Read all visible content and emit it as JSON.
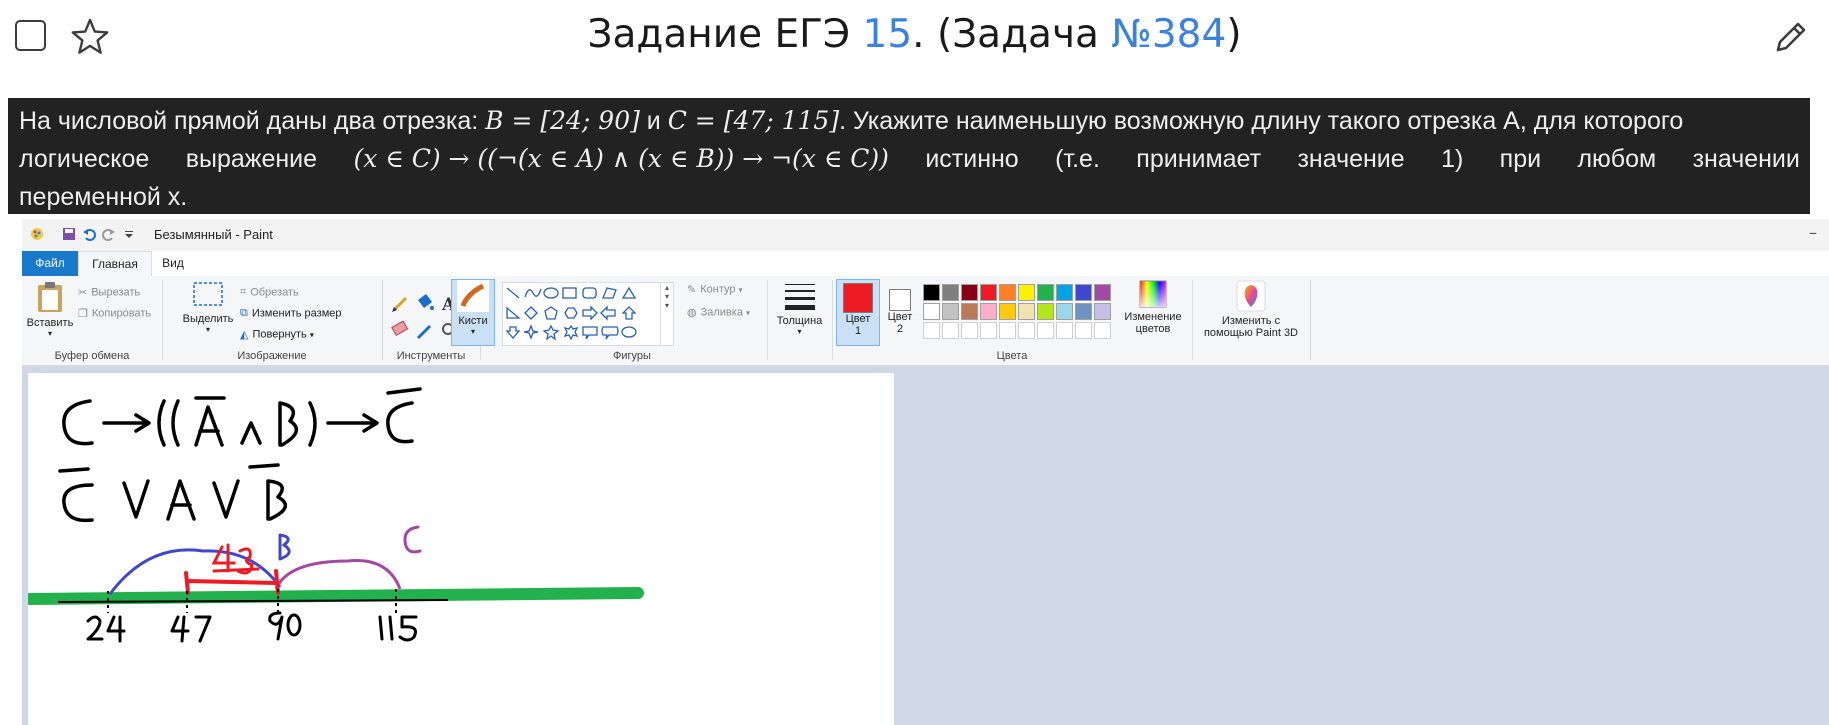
{
  "header": {
    "title_prefix": "Задание ЕГЭ ",
    "task_number": "15",
    "title_mid": ". (Задача ",
    "task_id": "№384",
    "title_suffix": ")"
  },
  "task": {
    "line1_a": "На числовой прямой даны два отрезка: ",
    "line1_B": "B = [24; 90]",
    "line1_and": " и ",
    "line1_C": "C = [47; 115]",
    "line1_b": ". Укажите наименьшую возможную длину такого отрезка A, для которого",
    "w_logical": "логическое",
    "w_expression": "выражение",
    "formula": "(x ∈ C) → ((¬(x ∈ A) ∧ (x ∈ B)) → ¬(x ∈ C))",
    "w_true": "истинно",
    "w_te": "(т.е.",
    "w_takes": "принимает",
    "w_value": "значение",
    "w_one": "1)",
    "w_at": "при",
    "w_any": "любом",
    "w_value2": "значении",
    "line3": "переменной х."
  },
  "paint": {
    "window_title": "Безымянный - Paint",
    "tabs": {
      "file": "Файл",
      "home": "Главная",
      "view": "Вид"
    },
    "clipboard": {
      "paste": "Вставить",
      "cut": "Вырезать",
      "copy": "Копировать",
      "label": "Буфер обмена"
    },
    "image": {
      "select": "Выделить",
      "crop": "Обрезать",
      "resize": "Изменить размер",
      "rotate": "Повернуть",
      "label": "Изображение"
    },
    "tools": {
      "label": "Инструменты"
    },
    "brushes": {
      "label": "Кисти"
    },
    "shapes": {
      "outline": "Контур",
      "fill": "Заливка",
      "label": "Фигуры"
    },
    "size": {
      "label": "Толщина"
    },
    "colors": {
      "color1_line1": "Цвет",
      "color1_line2": "1",
      "color2_line1": "Цвет",
      "color2_line2": "2",
      "edit_line1": "Изменение",
      "edit_line2": "цветов",
      "label": "Цвета",
      "color1_value": "#ed1c24",
      "color2_value": "#ffffff",
      "palette": [
        "#000000",
        "#7f7f7f",
        "#880015",
        "#ed1c24",
        "#ff7f27",
        "#fff200",
        "#22b14c",
        "#00a2e8",
        "#3f48cc",
        "#a349a4",
        "#ffffff",
        "#c3c3c3",
        "#b97a57",
        "#ffaec9",
        "#ffc90e",
        "#efe4b0",
        "#b5e61d",
        "#99d9ea",
        "#7092be",
        "#c8bfe7"
      ]
    },
    "paint3d": {
      "line1": "Изменить с",
      "line2": "помощью Paint 3D"
    }
  },
  "drawing": {
    "formula_line1": "C→((Ā ∧ B)→C̄",
    "formula_line2": "C̄ V A V B̄",
    "ticks": [
      "24",
      "47",
      "90",
      "115"
    ],
    "length_label": "43",
    "label_B": "B",
    "label_C": "C",
    "colors": {
      "ink": "#000000",
      "blue": "#3f48cc",
      "purple": "#a349a4",
      "red": "#ed1c24",
      "green": "#22b14c"
    }
  }
}
